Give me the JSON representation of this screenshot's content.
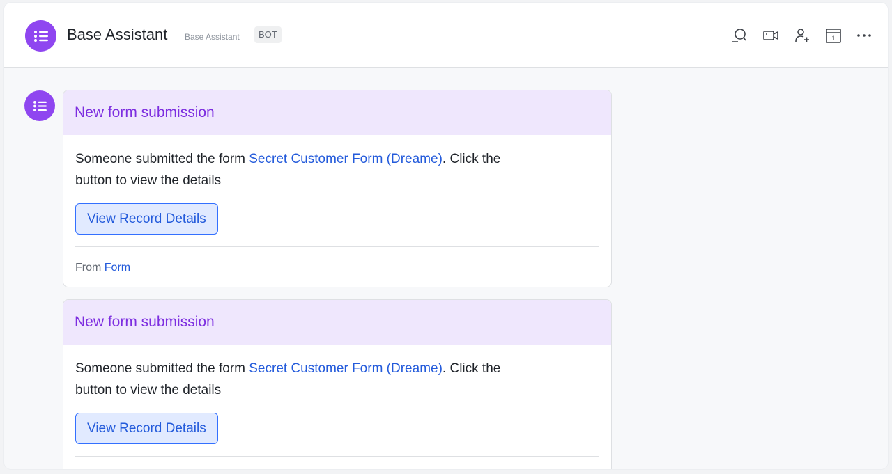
{
  "header": {
    "title": "Base Assistant",
    "subtitle": "Base Assistant",
    "badge": "BOT",
    "avatar_color": "#8f46f0",
    "icons": [
      "search-icon",
      "video-call-icon",
      "add-member-icon",
      "calendar-icon",
      "more-icon"
    ],
    "calendar_day": "1"
  },
  "messages": [
    {
      "title": "New form submission",
      "text_before": "Someone submitted the form ",
      "form_link": "Secret Customer Form (Dreame)",
      "text_after": ". Click the button to view the details",
      "button_label": "View Record Details",
      "footer_prefix": "From ",
      "footer_link": "Form"
    },
    {
      "title": "New form submission",
      "text_before": "Someone submitted the form ",
      "form_link": "Secret Customer Form (Dreame)",
      "text_after": ". Click the button to view the details",
      "button_label": "View Record Details"
    }
  ],
  "colors": {
    "accent_purple": "#7d2ee0",
    "card_header_bg": "#efe7fd",
    "link_blue": "#245bdb",
    "button_bg": "#e1eaff"
  }
}
